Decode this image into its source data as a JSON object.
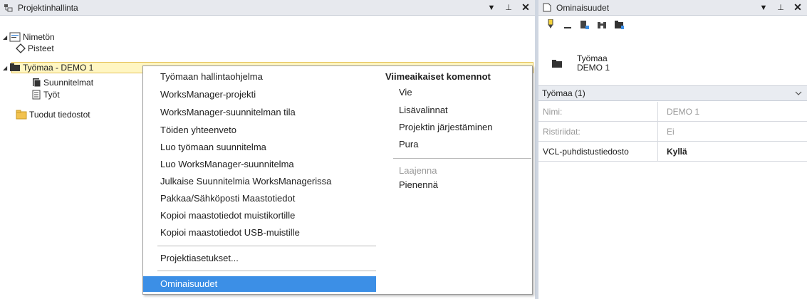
{
  "project_panel": {
    "title": "Projektinhallinta",
    "tree": [
      {
        "label": "Nimetön",
        "icon": "project-icon"
      },
      {
        "label": "Pisteet",
        "icon": "point-icon"
      },
      {
        "label": "Työmaa - DEMO 1",
        "icon": "folder-dark-icon"
      },
      {
        "label": "Suunnitelmat",
        "icon": "plans-icon"
      },
      {
        "label": "Työt",
        "icon": "document-icon"
      },
      {
        "label": "Tuodut tiedostot",
        "icon": "folder-yellow-icon"
      }
    ]
  },
  "context_menu": {
    "left": [
      "Työmaan hallintaohjelma",
      "WorksManager-projekti",
      "WorksManager-suunnitelman tila",
      "Töiden yhteenveto",
      "Luo työmaan suunnitelma",
      "Luo WorksManager-suunnitelma",
      "Julkaise Suunnitelmia WorksManagerissa",
      "Pakkaa/Sähköposti Maastotiedot",
      "Kopioi maastotiedot muistikortille",
      "Kopioi maastotiedot USB-muistille"
    ],
    "settings": "Projektiasetukset...",
    "properties": "Ominaisuudet",
    "recent_header": "Viimeaikaiset komennot",
    "recent": [
      "Vie",
      "Lisävalinnat",
      "Projektin järjestäminen",
      "Pura"
    ],
    "expand": "Laajenna",
    "collapse": "Pienennä"
  },
  "properties_panel": {
    "title": "Ominaisuudet",
    "object_type": "Työmaa",
    "object_name": "DEMO 1",
    "category": "Työmaa (1)",
    "rows": [
      {
        "key": "Nimi:",
        "value": "DEMO 1"
      },
      {
        "key": "Ristiriidat:",
        "value": "Ei"
      },
      {
        "key": "VCL-puhdistustiedosto",
        "value": "Kyllä"
      }
    ]
  },
  "colors": {
    "highlight": "#3c8fe6",
    "selection": "#fff6c2",
    "selection_border": "#e6c35a"
  }
}
